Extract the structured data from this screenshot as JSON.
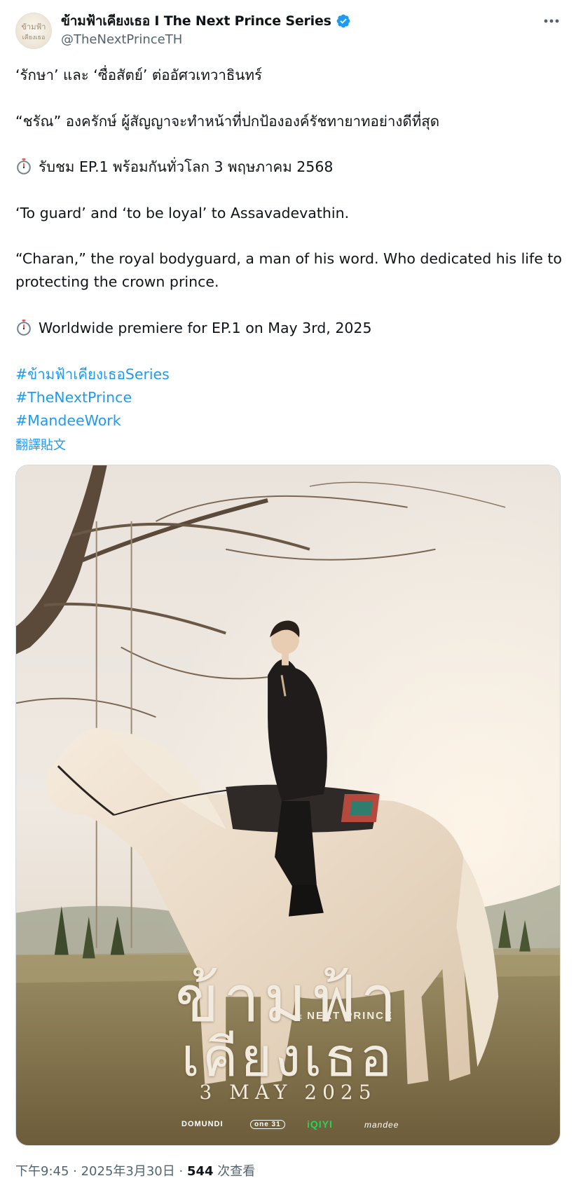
{
  "account": {
    "display_name": "ข้ามฟ้าเคียงเธอ I The Next Prince Series",
    "handle": "@TheNextPrinceTH",
    "avatar_text_line1": "ข้ามฟ้า",
    "avatar_text_line2": "เคียงเธอ",
    "verified": true,
    "verified_color": "#1d9bf0"
  },
  "post": {
    "line1": "‘รักษา’ และ ‘ซื่อสัตย์’ ต่ออัศวเทวาธินทร์",
    "line2": "“ชรัณ” องครักษ์ ผู้สัญญาจะทำหน้าที่ปกป้ององค์รัชทายาทอย่างดีที่สุด",
    "line3": "รับชม EP.1 พร้อมกันทั่วโลก 3 พฤษภาคม 2568",
    "line4": "‘To guard’ and ‘to be loyal’ to Assavadevathin.",
    "line5": "“Charan,” the royal bodyguard, a man of his word. Who dedicated his life to protecting the crown prince.",
    "line6": "Worldwide premiere for EP.1 on May 3rd, 2025",
    "timer_icon": "stopwatch-icon",
    "hashtags": [
      "#ข้ามฟ้าเคียงเธอSeries",
      "#TheNextPrince",
      "#MandeeWork"
    ],
    "translate_label": "翻譯貼文"
  },
  "media": {
    "poster_title_1": "ข้ามฟ้า",
    "poster_title_2": "เคียงเธอ",
    "poster_subtitle_small": "THE",
    "poster_subtitle": "NEXT PRINCE",
    "poster_date": "3 MAY 2025",
    "logos": [
      "DOMUNDI",
      "one 31",
      "iQIYI",
      "mandee"
    ]
  },
  "footer": {
    "time": "下午9:45",
    "sep1": " · ",
    "date": "2025年3月30日",
    "sep2": " · ",
    "views_count": "544",
    "views_label": " 次查看"
  },
  "colors": {
    "link": "#1d9bf0",
    "muted": "#536471",
    "text": "#0f1419"
  }
}
